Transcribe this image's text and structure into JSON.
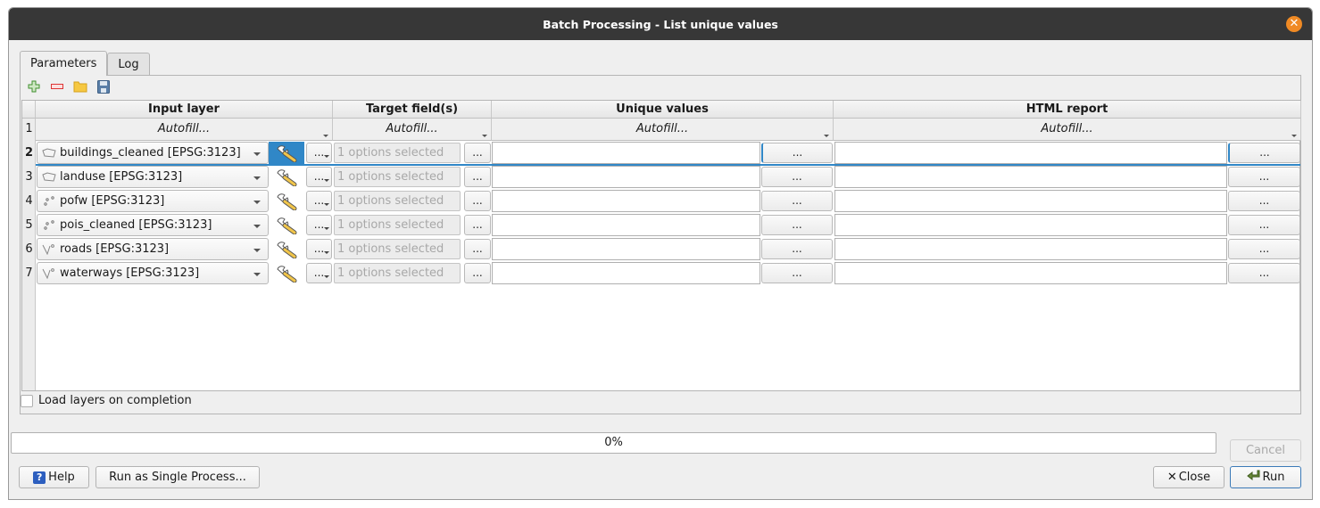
{
  "window": {
    "title": "Batch Processing - List unique values",
    "close_icon": "close-icon"
  },
  "tabs": [
    {
      "label": "Parameters",
      "active": true
    },
    {
      "label": "Log",
      "active": false
    }
  ],
  "toolbar": {
    "icons": [
      "add-row-icon",
      "remove-row-icon",
      "open-folder-icon",
      "save-icon"
    ]
  },
  "table": {
    "columns": [
      "Input layer",
      "Target field(s)",
      "Unique values",
      "HTML report"
    ],
    "autofill_label": "Autofill...",
    "autofill_row_number": "1",
    "rows": [
      {
        "num": "2",
        "layer": "buildings_cleaned [EPSG:3123]",
        "geom": "polygon",
        "target": "1 options selected",
        "unique": "",
        "html": "",
        "selected": true
      },
      {
        "num": "3",
        "layer": "landuse [EPSG:3123]",
        "geom": "polygon",
        "target": "1 options selected",
        "unique": "",
        "html": "",
        "selected": false
      },
      {
        "num": "4",
        "layer": "pofw [EPSG:3123]",
        "geom": "point",
        "target": "1 options selected",
        "unique": "",
        "html": "",
        "selected": false
      },
      {
        "num": "5",
        "layer": "pois_cleaned [EPSG:3123]",
        "geom": "point",
        "target": "1 options selected",
        "unique": "",
        "html": "",
        "selected": false
      },
      {
        "num": "6",
        "layer": "roads [EPSG:3123]",
        "geom": "line",
        "target": "1 options selected",
        "unique": "",
        "html": "",
        "selected": false
      },
      {
        "num": "7",
        "layer": "waterways [EPSG:3123]",
        "geom": "line",
        "target": "1 options selected",
        "unique": "",
        "html": "",
        "selected": false
      }
    ],
    "dots_label": "..."
  },
  "load_layers": {
    "label": "Load layers on completion",
    "checked": false
  },
  "progress": {
    "value": 0,
    "text": "0%"
  },
  "buttons": {
    "cancel": "Cancel",
    "help": "Help",
    "run_single": "Run as Single Process...",
    "close": "Close",
    "run": "Run"
  },
  "colors": {
    "titlebar": "#373737",
    "close_button": "#f08a24",
    "selection": "#3087c7"
  }
}
